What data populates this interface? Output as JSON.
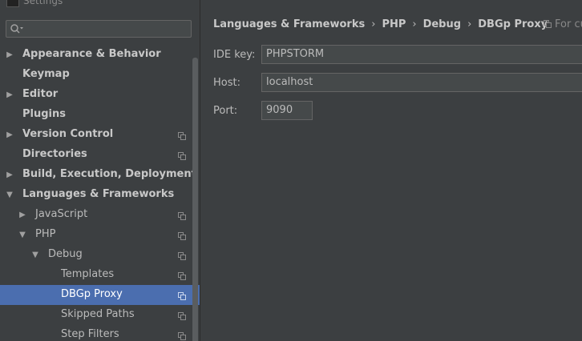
{
  "window": {
    "title": "Settings"
  },
  "search": {
    "value": ""
  },
  "tree": [
    {
      "label": "Appearance & Behavior",
      "bold": true,
      "arrow": "right",
      "level": 0,
      "project_icon": false,
      "selected": false
    },
    {
      "label": "Keymap",
      "bold": true,
      "arrow": "none",
      "level": 0,
      "project_icon": false,
      "selected": false
    },
    {
      "label": "Editor",
      "bold": true,
      "arrow": "right",
      "level": 0,
      "project_icon": false,
      "selected": false
    },
    {
      "label": "Plugins",
      "bold": true,
      "arrow": "none",
      "level": 0,
      "project_icon": false,
      "selected": false
    },
    {
      "label": "Version Control",
      "bold": true,
      "arrow": "right",
      "level": 0,
      "project_icon": true,
      "selected": false
    },
    {
      "label": "Directories",
      "bold": true,
      "arrow": "none",
      "level": 0,
      "project_icon": true,
      "selected": false
    },
    {
      "label": "Build, Execution, Deployment",
      "bold": true,
      "arrow": "right",
      "level": 0,
      "project_icon": false,
      "selected": false
    },
    {
      "label": "Languages & Frameworks",
      "bold": true,
      "arrow": "down",
      "level": 0,
      "project_icon": false,
      "selected": false
    },
    {
      "label": "JavaScript",
      "bold": false,
      "arrow": "right",
      "level": 1,
      "project_icon": true,
      "selected": false
    },
    {
      "label": "PHP",
      "bold": false,
      "arrow": "down",
      "level": 1,
      "project_icon": true,
      "selected": false
    },
    {
      "label": "Debug",
      "bold": false,
      "arrow": "down",
      "level": 2,
      "project_icon": true,
      "selected": false
    },
    {
      "label": "Templates",
      "bold": false,
      "arrow": "none",
      "level": 3,
      "project_icon": true,
      "selected": false
    },
    {
      "label": "DBGp Proxy",
      "bold": false,
      "arrow": "none",
      "level": 3,
      "project_icon": true,
      "selected": true
    },
    {
      "label": "Skipped Paths",
      "bold": false,
      "arrow": "none",
      "level": 3,
      "project_icon": true,
      "selected": false
    },
    {
      "label": "Step Filters",
      "bold": false,
      "arrow": "none",
      "level": 3,
      "project_icon": true,
      "selected": false
    }
  ],
  "breadcrumb": [
    "Languages & Frameworks",
    "PHP",
    "Debug",
    "DBGp Proxy"
  ],
  "breadcrumb_separator": "›",
  "for_current": "For cu",
  "form": {
    "ide_key": {
      "label": "IDE key:",
      "value": "PHPSTORM"
    },
    "host": {
      "label": "Host:",
      "value": "localhost"
    },
    "port": {
      "label": "Port:",
      "value": "9090"
    }
  },
  "colors": {
    "background": "#3c3f41",
    "selection": "#4b6eaf",
    "input_bg": "#45494a",
    "input_border": "#646464"
  }
}
